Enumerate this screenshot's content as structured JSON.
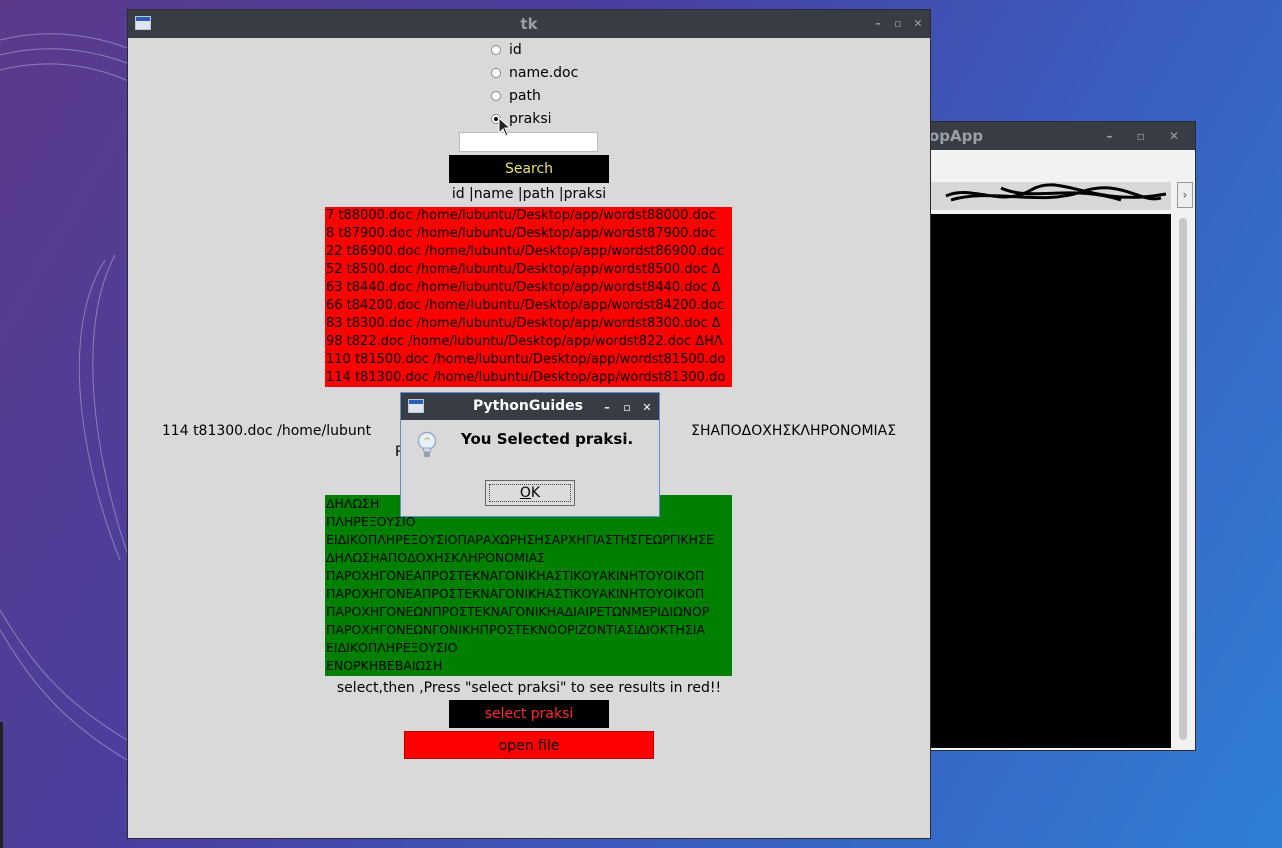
{
  "background_app": {
    "title": "opApp",
    "title_buttons": [
      "–",
      "▫",
      "✕"
    ]
  },
  "main_window": {
    "title": "tk",
    "radios": [
      {
        "label": "id",
        "selected": false
      },
      {
        "label": "name.doc",
        "selected": false
      },
      {
        "label": "path",
        "selected": false
      },
      {
        "label": "praksi",
        "selected": true
      }
    ],
    "search_value": "",
    "search_button": "Search",
    "header_label": "id |name |path |praksi",
    "results": [
      "7 t88000.doc /home/lubuntu/Desktop/app/wordst88000.doc",
      "8 t87900.doc /home/lubuntu/Desktop/app/wordst87900.doc",
      "22 t86900.doc /home/lubuntu/Desktop/app/wordst86900.doc",
      "52 t8500.doc /home/lubuntu/Desktop/app/wordst8500.doc Δ",
      "63 t8440.doc /home/lubuntu/Desktop/app/wordst8440.doc Δ",
      "66 t84200.doc /home/lubuntu/Desktop/app/wordst84200.doc",
      "83 t8300.doc /home/lubuntu/Desktop/app/wordst8300.doc Δ",
      "98 t822.doc /home/lubuntu/Desktop/app/wordst822.doc ΔΗΛ",
      "110 t81500.doc /home/lubuntu/Desktop/app/wordst81500.do",
      "114 t81300.doc /home/lubuntu/Desktop/app/wordst81300.do"
    ],
    "selected_line_left": "114 t81300.doc /home/lubunt",
    "selected_line_right": "ΣΗΑΠΟΔΟΧΗΣΚΛΗΡΟΝΟΜΙΑΣ",
    "selected_line2": "P",
    "praksi_list": [
      "ΔΗΛΩΣΗ",
      "ΠΛΗΡΕΞΟΥΣΙΟ",
      "ΕΙΔΙΚΟΠΛΗΡΕΞΟΥΣΙΟΠΑΡΑΧΩΡΗΣΗΣΑΡΧΗΓΙΑΣΤΗΣΓΕΩΡΓΙΚΗΣΕ",
      "ΔΗΛΩΣΗΑΠΟΔΟΧΗΣΚΛΗΡΟΝΟΜΙΑΣ",
      "ΠΑΡΟΧΗΓΟΝΕΑΠΡΟΣΤΕΚΝΑΓΟΝΙΚΗΑΣΤΙΚΟΥΑΚΙΝΗΤΟΥΟΙΚΟΠ",
      "ΠΑΡΟΧΗΓΟΝΕΑΠΡΟΣΤΕΚΝΑΓΟΝΙΚΗΑΣΤΙΚΟΥΑΚΙΝΗΤΟΥΟΙΚΟΠ",
      "ΠΑΡΟΧΗΓΟΝΕΩΝΠΡΟΣΤΕΚΝΑΓΟΝΙΚΗΑΔΙΑΙΡΕΤΩΝΜΕΡΙΔΙΩΝΟΡ",
      "ΠΑΡΟΧΗΓΟΝΕΩΝΓΟΝΙΚΗΠΡΟΣΤΕΚΝΟΟΡΙΖΟΝΤΙΑΣΙΔΙΟΚΤΗΣΙΑ",
      "ΕΙΔΙΚΟΠΛΗΡΕΞΟΥΣΙΟ",
      "ΕΝΟΡΚΗΒΕΒΑΙΩΣΗ"
    ],
    "hint_label": "select,then ,Press \"select praksi\" to see results in red!!",
    "select_button": "select praksi",
    "open_button": "open file"
  },
  "dialog": {
    "title": "PythonGuides",
    "message": "You Selected praksi.",
    "ok_prefix": "",
    "ok_underlined": "O",
    "ok_rest": "K"
  },
  "colors": {
    "titlebar": "#383c45",
    "window_bg": "#d9d9d9",
    "red_list": "#ff0000",
    "green_list": "#008000",
    "search_text": "#e8e36a",
    "select_text": "#ff2a2a"
  },
  "icons": [
    "app-window-icon",
    "lightbulb-icon",
    "minimize-icon",
    "maximize-icon",
    "close-icon",
    "mouse-cursor-icon"
  ]
}
